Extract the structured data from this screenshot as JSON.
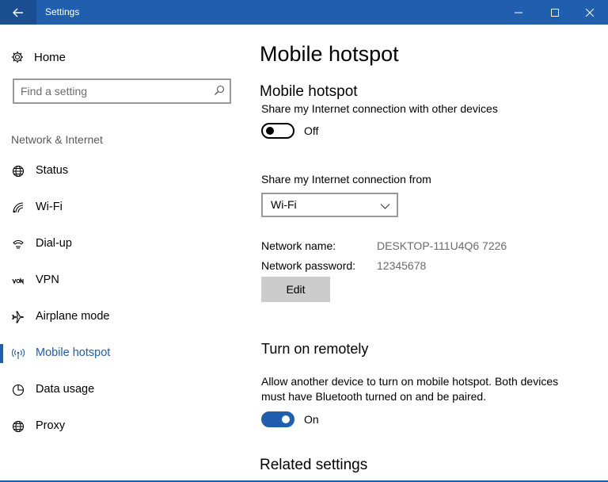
{
  "window": {
    "title": "Settings"
  },
  "sidebar": {
    "home_label": "Home",
    "search_placeholder": "Find a setting",
    "section_label": "Network & Internet",
    "items": [
      {
        "label": "Status",
        "icon": "globe-icon"
      },
      {
        "label": "Wi-Fi",
        "icon": "wifi-icon"
      },
      {
        "label": "Dial-up",
        "icon": "dialup-icon"
      },
      {
        "label": "VPN",
        "icon": "vpn-icon"
      },
      {
        "label": "Airplane mode",
        "icon": "airplane-icon"
      },
      {
        "label": "Mobile hotspot",
        "icon": "hotspot-icon",
        "active": true
      },
      {
        "label": "Data usage",
        "icon": "data-usage-icon"
      },
      {
        "label": "Proxy",
        "icon": "globe-icon"
      }
    ]
  },
  "main": {
    "page_title": "Mobile hotspot",
    "hotspot": {
      "heading": "Mobile hotspot",
      "description": "Share my Internet connection with other devices",
      "toggle_state": "Off"
    },
    "share_from": {
      "label": "Share my Internet connection from",
      "selected": "Wi-Fi"
    },
    "network": {
      "name_label": "Network name:",
      "name_value": "DESKTOP-111U4Q6 7226",
      "password_label": "Network password:",
      "password_value": "12345678",
      "edit_label": "Edit"
    },
    "remote": {
      "heading": "Turn on remotely",
      "description_line1": "Allow another device to turn on mobile hotspot. Both devices",
      "description_line2": "must have Bluetooth turned on and be paired.",
      "toggle_state": "On"
    },
    "related_heading": "Related settings"
  },
  "colors": {
    "accent": "#1f5fae",
    "titlebar": "#1f5fae",
    "secondary_text": "#6b6b6b",
    "button_bg": "#cccccc"
  }
}
